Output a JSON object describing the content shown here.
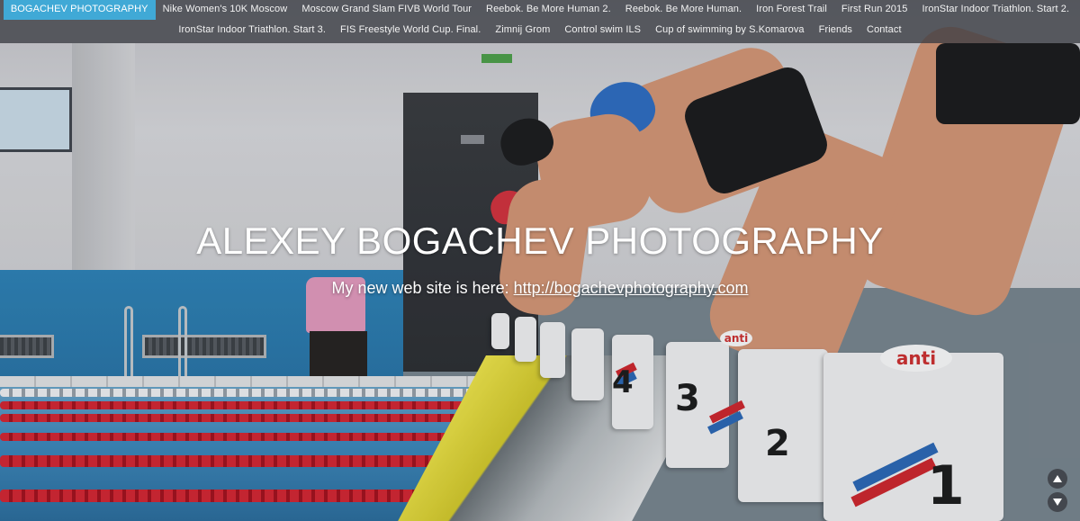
{
  "nav": {
    "row1": [
      {
        "label": "BOGACHEV PHOTOGRAPHY",
        "active": true
      },
      {
        "label": "Nike Women's 10K Moscow"
      },
      {
        "label": "Moscow Grand Slam FIVB World Tour"
      },
      {
        "label": "Reebok. Be More Human 2."
      },
      {
        "label": "Reebok. Be More Human."
      },
      {
        "label": "Iron Forest Trail"
      },
      {
        "label": "First Run 2015"
      },
      {
        "label": "IronStar Indoor Triathlon. Start 2."
      }
    ],
    "row2": [
      {
        "label": "IronStar Indoor Triathlon. Start 3."
      },
      {
        "label": "FIS Freestyle World Cup. Final."
      },
      {
        "label": "Zimnij Grom"
      },
      {
        "label": "Control swim ILS"
      },
      {
        "label": "Cup of swimming by S.Komarova"
      },
      {
        "label": "Friends"
      },
      {
        "label": "Contact"
      }
    ]
  },
  "hero": {
    "title": "ALEXEY BOGACHEV PHOTOGRAPHY",
    "subtitle_prefix": "My new web site is here: ",
    "subtitle_link": "http://bogachevphotography.com",
    "start_block_brand": "anti",
    "block_numbers": [
      "1",
      "2",
      "3",
      "4"
    ]
  },
  "scroll": {
    "up_icon": "triangle-up-icon",
    "down_icon": "triangle-down-icon"
  },
  "colors": {
    "nav_active": "#40a9d6",
    "nav_bg": "#3a3c42",
    "pool_blue": "#3f8bc0",
    "lane_red": "#d72633"
  }
}
